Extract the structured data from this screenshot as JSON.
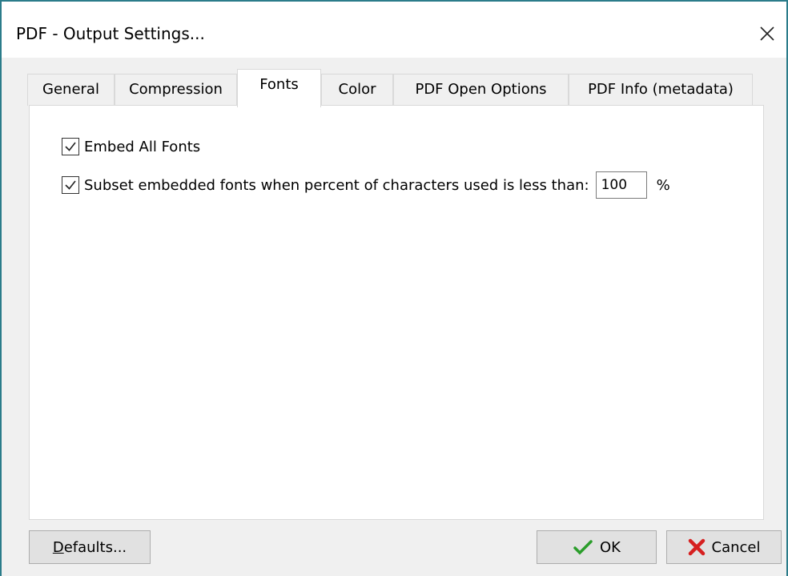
{
  "window": {
    "title": "PDF - Output Settings..."
  },
  "tabs": [
    {
      "label": "General"
    },
    {
      "label": "Compression"
    },
    {
      "label": "Fonts"
    },
    {
      "label": "Color"
    },
    {
      "label": "PDF Open Options"
    },
    {
      "label": "PDF Info (metadata)"
    }
  ],
  "active_tab": "Fonts",
  "fonts": {
    "embed_all": {
      "label": "Embed All Fonts",
      "checked": true
    },
    "subset": {
      "label": "Subset embedded fonts when percent of characters used is less than:",
      "checked": true,
      "value": "100",
      "unit": "%"
    }
  },
  "buttons": {
    "defaults_first": "D",
    "defaults_rest": "efaults...",
    "ok": "OK",
    "cancel": "Cancel"
  },
  "colors": {
    "ok_check": "#2a9d2a",
    "cancel_x": "#d62020",
    "window_border": "#2b7c8a"
  }
}
